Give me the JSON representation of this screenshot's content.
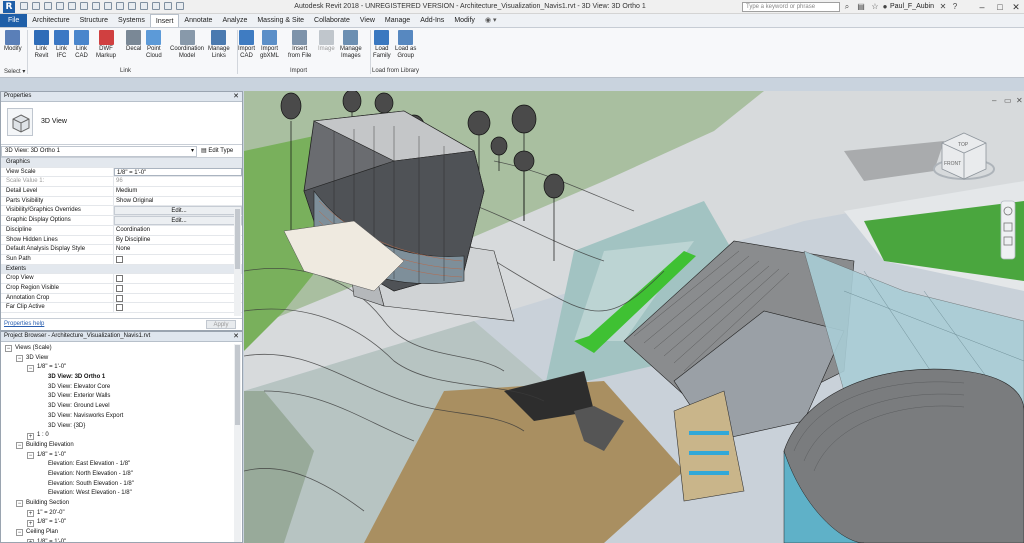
{
  "app": {
    "logo": "R",
    "title": "Autodesk Revit 2018 - UNREGISTERED VERSION -   Architecture_Visualization_Navis1.rvt - 3D View: 3D Ortho 1"
  },
  "search": {
    "placeholder": "Type a keyword or phrase"
  },
  "user": {
    "name": "Paul_F_Aubin"
  },
  "tabs": [
    "File",
    "Architecture",
    "Structure",
    "Systems",
    "Insert",
    "Annotate",
    "Analyze",
    "Massing & Site",
    "Collaborate",
    "View",
    "Manage",
    "Add-Ins",
    "Modify"
  ],
  "active_tab": "Insert",
  "ribbon": {
    "buttons": [
      {
        "label": "Modify",
        "icon": "cursor-icon",
        "color": "#5a7fb8"
      },
      {
        "label": "Link\nRevit",
        "icon": "link-revit-icon",
        "color": "#2e6cb8"
      },
      {
        "label": "Link\nIFC",
        "icon": "link-ifc-icon",
        "color": "#3b78c4"
      },
      {
        "label": "Link\nCAD",
        "icon": "link-cad-icon",
        "color": "#4a86cc"
      },
      {
        "label": "DWF\nMarkup",
        "icon": "dwf-markup-icon",
        "color": "#d04040"
      },
      {
        "label": "Decal\n",
        "icon": "decal-icon",
        "color": "#7a8896"
      },
      {
        "label": "Point\nCloud",
        "icon": "point-cloud-icon",
        "color": "#5c9ad8"
      },
      {
        "label": "Coordination\nModel",
        "icon": "coordination-model-icon",
        "color": "#8899aa"
      },
      {
        "label": "Manage\nLinks",
        "icon": "manage-links-icon",
        "color": "#4a7ab0"
      },
      {
        "label": "Import\nCAD",
        "icon": "import-cad-icon",
        "color": "#3f7cc2"
      },
      {
        "label": "Import\ngbXML",
        "icon": "import-gbxml-icon",
        "color": "#5b8fc8"
      },
      {
        "label": "Insert\nfrom File",
        "icon": "insert-file-icon",
        "color": "#7e93aa"
      },
      {
        "label": "Image",
        "icon": "image-icon",
        "color": "#c0c6cc"
      },
      {
        "label": "Manage\nImages",
        "icon": "manage-images-icon",
        "color": "#6c8fb2"
      },
      {
        "label": "Load\nFamily",
        "icon": "load-family-icon",
        "color": "#3a78c0"
      },
      {
        "label": "Load as\nGroup",
        "icon": "load-group-icon",
        "color": "#5788c0"
      }
    ],
    "panels": {
      "select": "Select ▾",
      "link": "Link",
      "import": "Import",
      "load": "Load from Library"
    }
  },
  "properties": {
    "header": "Properties",
    "type_name": "3D View",
    "view_selector": "3D View: 3D Ortho 1",
    "edit_type": "Edit Type",
    "rows": [
      {
        "k": "Graphics",
        "v": "",
        "group": true
      },
      {
        "k": "View Scale",
        "v": "1/8\" = 1'-0\"",
        "kind": "input"
      },
      {
        "k": "Scale Value    1:",
        "v": "96",
        "dim": true
      },
      {
        "k": "Detail Level",
        "v": "Medium"
      },
      {
        "k": "Parts Visibility",
        "v": "Show Original"
      },
      {
        "k": "Visibility/Graphics Overrides",
        "v": "Edit...",
        "kind": "btn"
      },
      {
        "k": "Graphic Display Options",
        "v": "Edit...",
        "kind": "btn"
      },
      {
        "k": "Discipline",
        "v": "Coordination"
      },
      {
        "k": "Show Hidden Lines",
        "v": "By Discipline"
      },
      {
        "k": "Default Analysis Display Style",
        "v": "None"
      },
      {
        "k": "Sun Path",
        "v": "",
        "kind": "check"
      },
      {
        "k": "Extents",
        "v": "",
        "group": true
      },
      {
        "k": "Crop View",
        "v": "",
        "kind": "check"
      },
      {
        "k": "Crop Region Visible",
        "v": "",
        "kind": "check"
      },
      {
        "k": "Annotation Crop",
        "v": "",
        "kind": "check"
      },
      {
        "k": "Far Clip Active",
        "v": "",
        "kind": "check"
      }
    ],
    "help": "Properties help",
    "apply": "Apply"
  },
  "browser": {
    "header": "Project Browser - Architecture_Visualization_Navis1.rvt",
    "nodes": [
      {
        "t": "Views (Scale)",
        "d": 0,
        "tg": "−"
      },
      {
        "t": "3D View",
        "d": 1,
        "tg": "−"
      },
      {
        "t": "1/8\" = 1'-0\"",
        "d": 2,
        "tg": "−"
      },
      {
        "t": "3D View: 3D Ortho 1",
        "d": 3,
        "tg": "",
        "bold": true
      },
      {
        "t": "3D View: Elevator Core",
        "d": 3,
        "tg": ""
      },
      {
        "t": "3D View: Exterior Walls",
        "d": 3,
        "tg": ""
      },
      {
        "t": "3D View: Ground Level",
        "d": 3,
        "tg": ""
      },
      {
        "t": "3D View: Navisworks Export",
        "d": 3,
        "tg": ""
      },
      {
        "t": "3D View: {3D}",
        "d": 3,
        "tg": ""
      },
      {
        "t": "1 : 0",
        "d": 2,
        "tg": "+"
      },
      {
        "t": "Building Elevation",
        "d": 1,
        "tg": "−"
      },
      {
        "t": "1/8\" = 1'-0\"",
        "d": 2,
        "tg": "−"
      },
      {
        "t": "Elevation: East Elevation - 1/8\"",
        "d": 3,
        "tg": ""
      },
      {
        "t": "Elevation: North Elevation - 1/8\"",
        "d": 3,
        "tg": ""
      },
      {
        "t": "Elevation: South Elevation - 1/8\"",
        "d": 3,
        "tg": ""
      },
      {
        "t": "Elevation: West Elevation - 1/8\"",
        "d": 3,
        "tg": ""
      },
      {
        "t": "Building Section",
        "d": 1,
        "tg": "−"
      },
      {
        "t": "1\" = 20'-0\"",
        "d": 2,
        "tg": "+"
      },
      {
        "t": "1/8\" = 1'-0\"",
        "d": 2,
        "tg": "+"
      },
      {
        "t": "Ceiling Plan",
        "d": 1,
        "tg": "−"
      },
      {
        "t": "1/8\" = 1'-0\"",
        "d": 2,
        "tg": "+"
      }
    ]
  },
  "viewcube": {
    "top": "TOP",
    "front": "FRONT"
  }
}
